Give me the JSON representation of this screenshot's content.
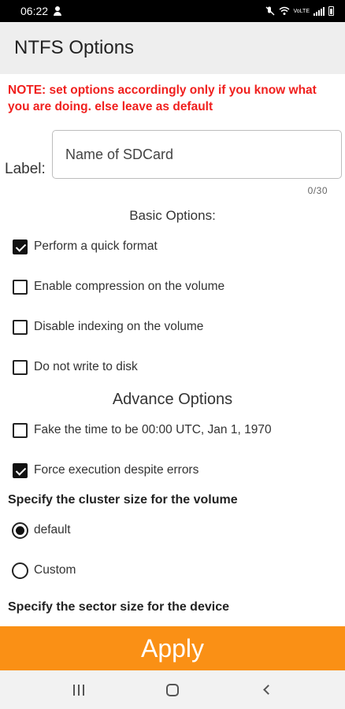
{
  "status_bar": {
    "time": "06:22",
    "network_label": "VoLTE",
    "icons": [
      "person-icon",
      "mute-icon",
      "wifi-icon",
      "signal-icon",
      "battery-icon"
    ]
  },
  "app_bar": {
    "title": "NTFS Options"
  },
  "note": "NOTE: set options accordingly only if you know what you are doing. else leave as default",
  "label_field": {
    "label": "Label:",
    "placeholder": "Name of SDCard",
    "value": "",
    "counter": "0/30"
  },
  "basic_options": {
    "title": "Basic Options:",
    "items": [
      {
        "label": "Perform a quick format",
        "checked": true
      },
      {
        "label": "Enable compression on the volume",
        "checked": false
      },
      {
        "label": "Disable indexing on the volume",
        "checked": false
      },
      {
        "label": "Do not write to disk",
        "checked": false
      }
    ]
  },
  "advance_options": {
    "title": "Advance Options",
    "items": [
      {
        "label": "Fake the time to be 00:00 UTC, Jan 1, 1970",
        "checked": false
      },
      {
        "label": "Force execution despite errors",
        "checked": true
      }
    ]
  },
  "cluster_size": {
    "heading": "Specify the cluster size for the volume",
    "options": [
      {
        "label": "default",
        "selected": true
      },
      {
        "label": "Custom",
        "selected": false
      }
    ]
  },
  "sector_size": {
    "heading": "Specify the sector size for the device"
  },
  "apply_button": {
    "label": "Apply",
    "color": "#fa9015"
  },
  "nav_bar": {
    "icons": [
      "recents-icon",
      "home-icon",
      "back-icon"
    ]
  }
}
